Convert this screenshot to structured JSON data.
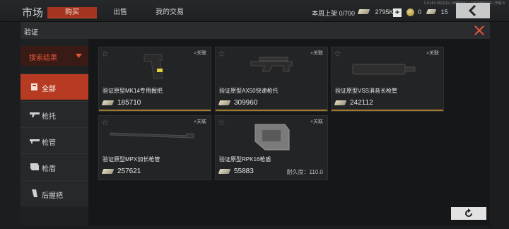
{
  "header": {
    "title": "市场",
    "tabs": [
      {
        "label": "购买"
      },
      {
        "label": "出售"
      },
      {
        "label": "我的交易"
      }
    ],
    "listing_label": "本周上架 0/700",
    "currency_value": "2795K",
    "coin_value": "0",
    "voucher_value": "15",
    "build_info": "1.0.163.1621(1) | 09050947 | 11668858430 | 华硕-5"
  },
  "dialog": {
    "title": "验证"
  },
  "sidebar": {
    "header_label": "搜索结果",
    "items": [
      {
        "label": "全部",
        "icon": "grid-icon"
      },
      {
        "label": "枪托",
        "icon": "stock-icon"
      },
      {
        "label": "枪管",
        "icon": "barrel-icon"
      },
      {
        "label": "枪盾",
        "icon": "shield-icon"
      },
      {
        "label": "后握把",
        "icon": "grip-icon"
      }
    ]
  },
  "items": [
    {
      "name": "验证原型MK14专用握把",
      "price": "185710",
      "relate": "关联"
    },
    {
      "name": "验证原型AX50快速枪托",
      "price": "309960",
      "relate": "关联"
    },
    {
      "name": "验证原型VSS消音长枪管",
      "price": "242112",
      "relate": "关联"
    },
    {
      "name": "验证原型MPX加长枪管",
      "price": "257621",
      "relate": "关联"
    },
    {
      "name": "验证原型RPK16枪盾",
      "price": "55883",
      "relate": "关联",
      "durability": "耐久度：110.0"
    }
  ],
  "colors": {
    "accent": "#b63b22",
    "strip": "#a07a2a"
  }
}
